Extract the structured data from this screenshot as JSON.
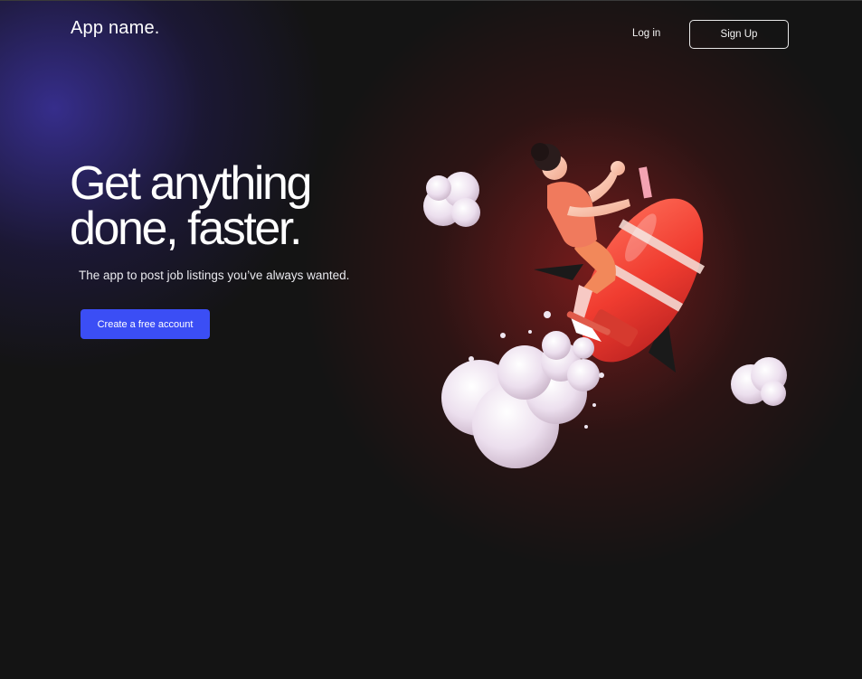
{
  "header": {
    "logo_text": "App name.",
    "login_label": "Log in",
    "signup_label": "Sign Up"
  },
  "hero": {
    "headline_line1": "Get anything",
    "headline_line2": "done, faster.",
    "subheading": "The app to post job listings you’ve always wanted.",
    "cta_label": "Create a free account",
    "illustration": "rocket-rider-illustration"
  },
  "colors": {
    "background": "#141414",
    "accent_blue": "#3b4ef5",
    "glow_purple": "#3c32a0",
    "glow_red": "#961e1e"
  }
}
